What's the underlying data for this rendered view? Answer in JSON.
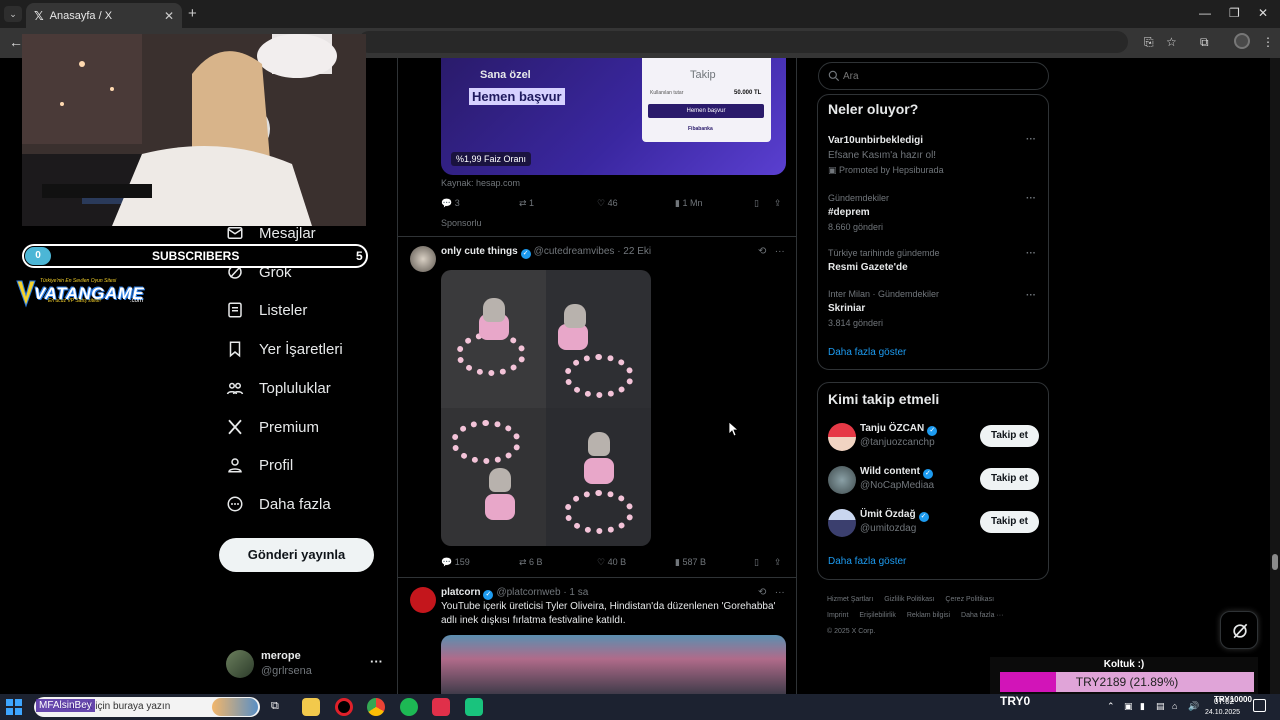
{
  "browser": {
    "tab_title": "Anasayfa / X",
    "new_tab": "+",
    "tab_close": "✕",
    "minimize": "—",
    "restore": "❐",
    "close": "✕"
  },
  "nav": {
    "items": [
      {
        "label": "Mesajlar",
        "icon": "mail-icon"
      },
      {
        "label": "Grok",
        "icon": "grok-icon"
      },
      {
        "label": "Listeler",
        "icon": "list-icon"
      },
      {
        "label": "Yer İşaretleri",
        "icon": "bookmark-icon"
      },
      {
        "label": "Topluluklar",
        "icon": "communities-icon"
      },
      {
        "label": "Premium",
        "icon": "x-logo-icon"
      },
      {
        "label": "Profil",
        "icon": "profile-icon"
      },
      {
        "label": "Daha fazla",
        "icon": "more-circle-icon"
      }
    ],
    "post_button": "Gönderi yayınla",
    "account": {
      "name": "merope",
      "handle": "@grlrsena",
      "more": "···"
    }
  },
  "feed": {
    "tabs": {
      "for_you": "Sana özel",
      "following": "Takip"
    },
    "ad": {
      "headline": "Hemen başvur",
      "rate_badge": "%1,99 Faiz Oranı",
      "card_button": "Hemen başvur",
      "card_amount": "50.000 TL",
      "source": "Kaynak: hesap.com",
      "stats": {
        "replies": "3",
        "reposts": "1",
        "likes": "46",
        "views": "1 Mn"
      },
      "sponsored": "Sponsorlu"
    },
    "post2": {
      "name": "only cute things",
      "handle": "@cutedreamvibes",
      "time": "· 22 Eki",
      "stats": {
        "replies": "159",
        "reposts": "6 B",
        "likes": "40 B",
        "views": "587 B"
      }
    },
    "post3": {
      "name": "platcorn",
      "handle": "@platcornweb",
      "time": "· 1 sa",
      "text": "YouTube içerik üreticisi Tyler Oliveira, Hindistan'da düzenlenen 'Gorehabba' adlı inek dışkısı fırlatma festivaline katıldı."
    }
  },
  "sidebar": {
    "search_placeholder": "Ara",
    "trends_title": "Neler oluyor?",
    "trends": [
      {
        "context": "",
        "name": "Var10unbirbekledigi",
        "sub": "Efsane Kasım'a hazır ol!",
        "promoted": "Promoted by Hepsiburada"
      },
      {
        "context": "Gündemdekiler",
        "name": "#deprem",
        "sub": "8.660 gönderi"
      },
      {
        "context": "Türkiye tarihinde gündemde",
        "name": "Resmi Gazete'de",
        "sub": ""
      },
      {
        "context": "Inter Milan · Gündemdekiler",
        "name": "Skriniar",
        "sub": "3.814 gönderi"
      }
    ],
    "show_more": "Daha fazla göster",
    "wtf_title": "Kimi takip etmeli",
    "who_to_follow": [
      {
        "name": "Tanju ÖZCAN",
        "handle": "@tanjuozcanchp",
        "button": "Takip et"
      },
      {
        "name": "Wild content",
        "handle": "@NoCapMediaa",
        "button": "Takip et"
      },
      {
        "name": "Ümit Özdağ",
        "handle": "@umitozdag",
        "button": "Takip et"
      }
    ],
    "wtf_show_more": "Daha fazla göster",
    "footer": [
      "Hizmet Şartları",
      "Gizlilik Politikası",
      "Çerez Politikası",
      "Imprint",
      "Erişilebilirlik",
      "Reklam bilgisi",
      "Daha fazla ···",
      "© 2025 X Corp."
    ]
  },
  "overlay": {
    "subscribers_count": "0",
    "subscribers_label": "SUBSCRIBERS",
    "subscribers_goal": "5",
    "logo_tagline": "Türkiye'nin En Sevilen Oyun Sitesi",
    "logo_name": "VATANGAME",
    "logo_subline": "En ucuz VP Satış sitesi!",
    "logo_com": ".com",
    "koltuk_title": "Koltuk :)",
    "koltuk_progress": "TRY2189 (21.89%)",
    "koltuk_fraction": 0.2189,
    "koltuk_left": "TRY0",
    "koltuk_right": "TRY10000"
  },
  "taskbar": {
    "user": "MFAlsinBey",
    "search_placeholder": "Aramak için buraya yazın",
    "date": "24.10.2025",
    "time": "07:02"
  },
  "colors": {
    "accent": "#1d9bf0",
    "koltuk_fill": "#d214b8",
    "koltuk_bg": "#e0a4d8"
  }
}
